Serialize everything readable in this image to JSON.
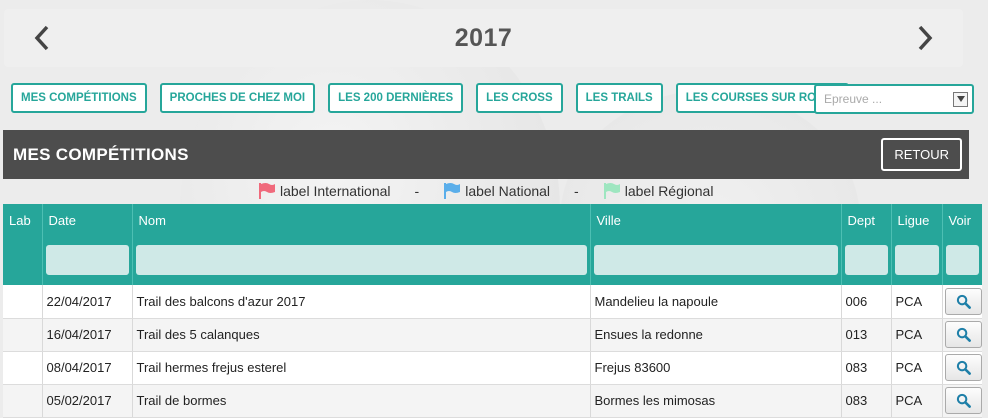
{
  "year_nav": {
    "year": "2017",
    "prev_icon": "chevron-left-icon",
    "next_icon": "chevron-right-icon"
  },
  "filters": [
    {
      "label": "MES COMPÉTITIONS"
    },
    {
      "label": "PROCHES DE CHEZ MOI"
    },
    {
      "label": "LES 200 DERNIÈRES"
    },
    {
      "label": "LES CROSS"
    },
    {
      "label": "LES TRAILS"
    },
    {
      "label": "LES COURSES SUR ROUTE"
    }
  ],
  "epreuve_select": {
    "placeholder": "Epreuve ..."
  },
  "section": {
    "title": "MES COMPÉTITIONS",
    "retour_label": "RETOUR"
  },
  "legend": [
    {
      "label": "label International",
      "color": "#f06a7c"
    },
    {
      "label": "label National",
      "color": "#5aaeea"
    },
    {
      "label": "label Régional",
      "color": "#9ee6c0"
    }
  ],
  "legend_separator": "-",
  "table": {
    "columns": [
      "Lab",
      "Date",
      "Nom",
      "Ville",
      "Dept",
      "Ligue",
      "Voir"
    ],
    "rows": [
      {
        "lab": "",
        "date": "22/04/2017",
        "nom": "Trail des balcons d'azur 2017",
        "ville": "Mandelieu la napoule",
        "dept": "006",
        "ligue": "PCA"
      },
      {
        "lab": "",
        "date": "16/04/2017",
        "nom": "Trail des 5 calanques",
        "ville": "Ensues la redonne",
        "dept": "013",
        "ligue": "PCA"
      },
      {
        "lab": "",
        "date": "08/04/2017",
        "nom": "Trail hermes frejus esterel",
        "ville": "Frejus 83600",
        "dept": "083",
        "ligue": "PCA"
      },
      {
        "lab": "",
        "date": "05/02/2017",
        "nom": "Trail de bormes",
        "ville": "Bormes les mimosas",
        "dept": "083",
        "ligue": "PCA"
      }
    ]
  },
  "colors": {
    "accent": "#26a69a",
    "section_bg": "#4d4d4d"
  }
}
